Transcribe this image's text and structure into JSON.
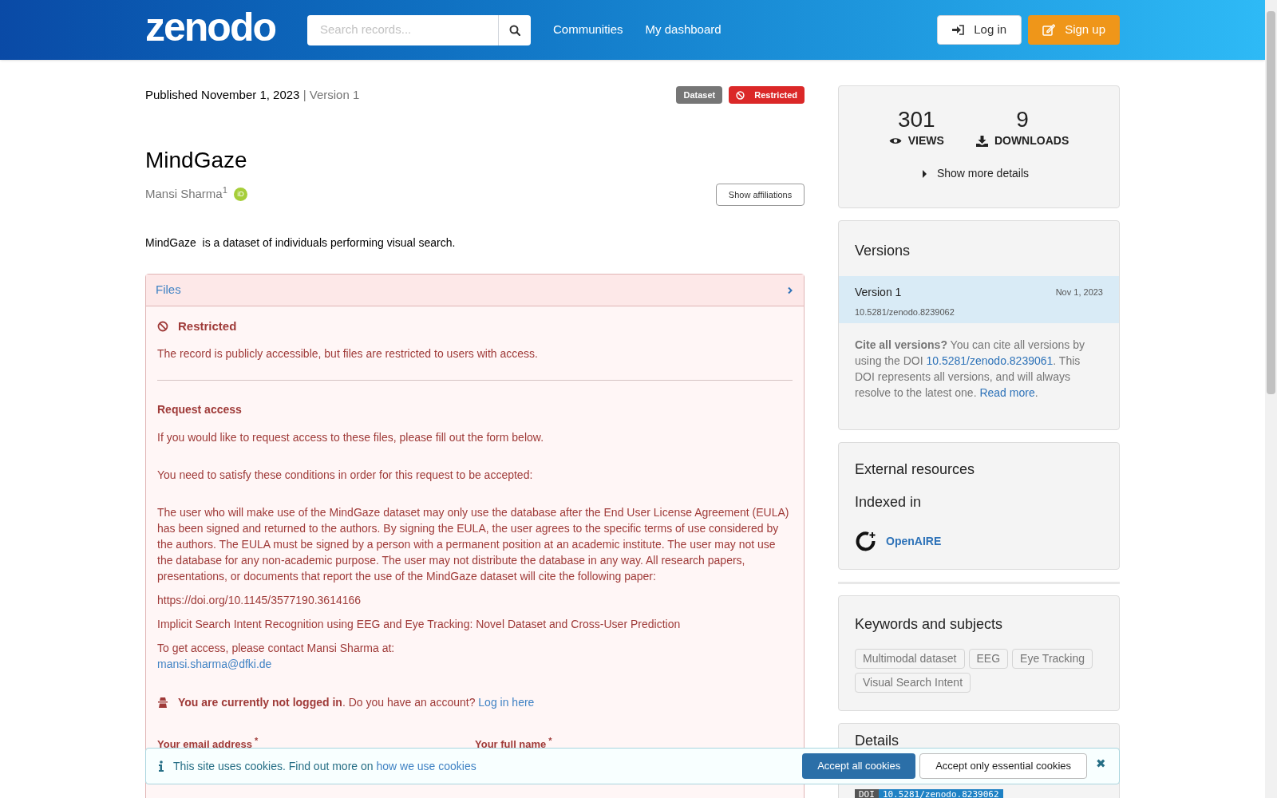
{
  "header": {
    "logo": "zenodo",
    "search": {
      "placeholder": "Search records..."
    },
    "nav": [
      "Communities",
      "My dashboard"
    ],
    "buttons": [
      {
        "label": "Log in",
        "kind": "login"
      },
      {
        "label": "Sign up",
        "kind": "signup"
      }
    ]
  },
  "record": {
    "published": "Published November 1, 2023",
    "version": "| Version 1",
    "badges": [
      {
        "label": "Dataset",
        "kind": "type"
      },
      {
        "label": "Restricted",
        "kind": "access"
      }
    ],
    "title": "MindGaze",
    "creators": [
      {
        "name": "Mansi Sharma",
        "affiliation_mark": "1",
        "orcid": "iD"
      }
    ],
    "show_affiliations": "Show affiliations",
    "description": "MindGaze  is a dataset of individuals performing visual search."
  },
  "files": {
    "title": "Files",
    "expanded": false,
    "restricted_title": "Restricted",
    "restricted_text": "The record is publicly accessible, but files are restricted to users with access.",
    "request_title": "Request access",
    "request_intro": "If you would like to request access to these files, please fill out the form below.",
    "conditions_intro": "You need to satisfy these conditions in order for this request to be accepted:",
    "conditions": [
      "The user who will make use of the MindGaze dataset may only use the database after the End User License Agreement (EULA) has been signed and returned to the authors. By signing the EULA, the user agrees to the specific terms of use considered by the authors. The EULA must be signed by a person with a permanent position at an academic institute. The user may not use the database for any non-academic purpose. The user may not distribute the database in any way. All research papers, presentations, or documents that report the use of the MindGaze dataset will cite the following paper:",
      "https://doi.org/10.1145/3577190.3614166",
      "Implicit Search Intent Recognition using EEG and Eye Tracking: Novel Dataset and Cross-User Prediction"
    ],
    "contact": "To get access, please contact Mansi Sharma at:",
    "contact_email": "mansi.sharma@dfki.de",
    "login_note": [
      {
        "text": "**You are currently not logged in**. Do you have an account? "
      },
      {
        "link": "Log in here"
      }
    ],
    "required_mark": "*",
    "form_labels": [
      {
        "label": "Your email address",
        "required": true
      },
      {
        "label": "Your full name",
        "required": true
      }
    ]
  },
  "stats": {
    "items": [
      {
        "value": "301",
        "label": "VIEWS",
        "kind": "views"
      },
      {
        "value": "9",
        "label": "DOWNLOADS",
        "kind": "downloads"
      }
    ],
    "more": "Show more details"
  },
  "versions": {
    "title": "Versions",
    "items": [
      {
        "label": "Version 1",
        "date": "Nov 1, 2023",
        "doi": "10.5281/zenodo.8239062",
        "selected": true
      }
    ],
    "cite": [
      {
        "text": "**Cite all versions?** You can cite all versions by using the DOI "
      },
      {
        "link": "10.5281/zenodo.8239061"
      },
      {
        "text": ". This DOI represents all versions, and will always resolve to the latest one. "
      },
      {
        "link": "Read more"
      },
      {
        "text": "."
      }
    ]
  },
  "external": {
    "title": "External resources",
    "subtitle": "Indexed in",
    "items": [
      "OpenAIRE"
    ]
  },
  "keywords": {
    "title": "Keywords and subjects",
    "items": [
      "Multimodal dataset",
      "EEG",
      "Eye Tracking",
      "Visual Search Intent"
    ]
  },
  "details": {
    "title": "Details",
    "doi_label": "DOI",
    "doi": "10.5281/zenodo.8239062"
  },
  "cookie_banner": {
    "text": [
      {
        "text": "This site uses cookies. Find out more on "
      },
      {
        "link": "how we use cookies"
      }
    ],
    "accept_all": "Accept all cookies",
    "accept_essential": "Accept only essential cookies",
    "close": "✖"
  }
}
